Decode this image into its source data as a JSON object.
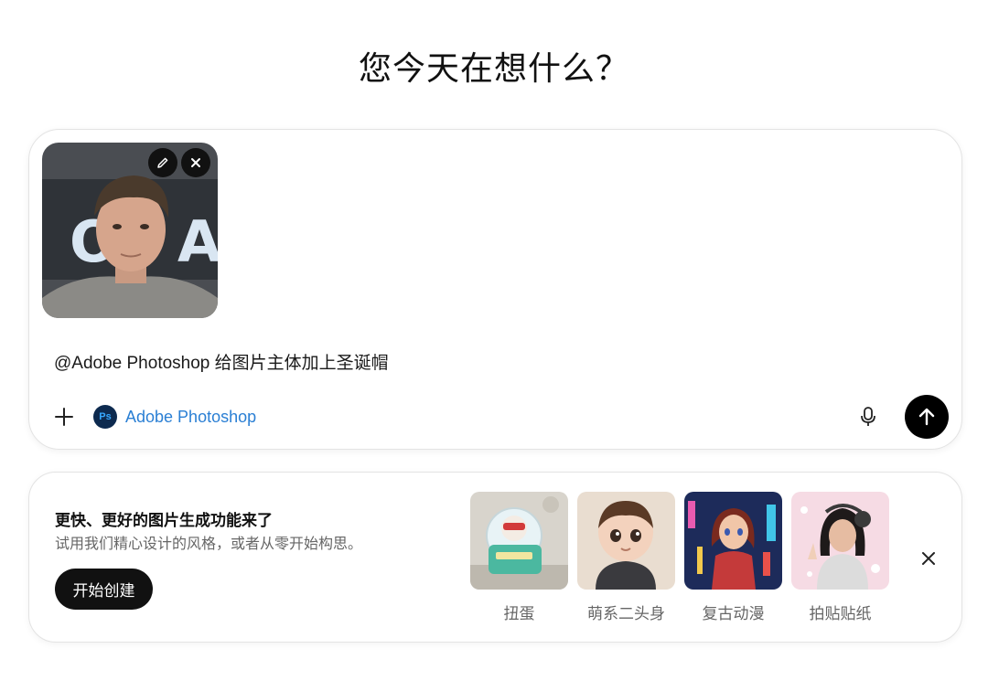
{
  "heading": "您今天在想什么？",
  "composer": {
    "attachment_alt": "portrait photo",
    "edit_icon": "pencil-icon",
    "remove_icon": "close-icon",
    "prompt_text": "@Adobe Photoshop 给图片主体加上圣诞帽",
    "tool": {
      "icon_text": "Ps",
      "label": "Adobe Photoshop"
    },
    "icons": {
      "add": "plus-icon",
      "mic": "microphone-icon",
      "send": "arrow-up-icon"
    }
  },
  "promo": {
    "title": "更快、更好的图片生成功能来了",
    "subtitle": "试用我们精心设计的风格，或者从零开始构思。",
    "button": "开始创建",
    "styles": [
      {
        "label": "扭蛋"
      },
      {
        "label": "萌系二头身"
      },
      {
        "label": "复古动漫"
      },
      {
        "label": "拍贴贴纸"
      }
    ],
    "close_icon": "close-icon"
  },
  "colors": {
    "accent": "#2a7fd4",
    "ps_bg": "#0d2a4f",
    "button": "#111111"
  }
}
